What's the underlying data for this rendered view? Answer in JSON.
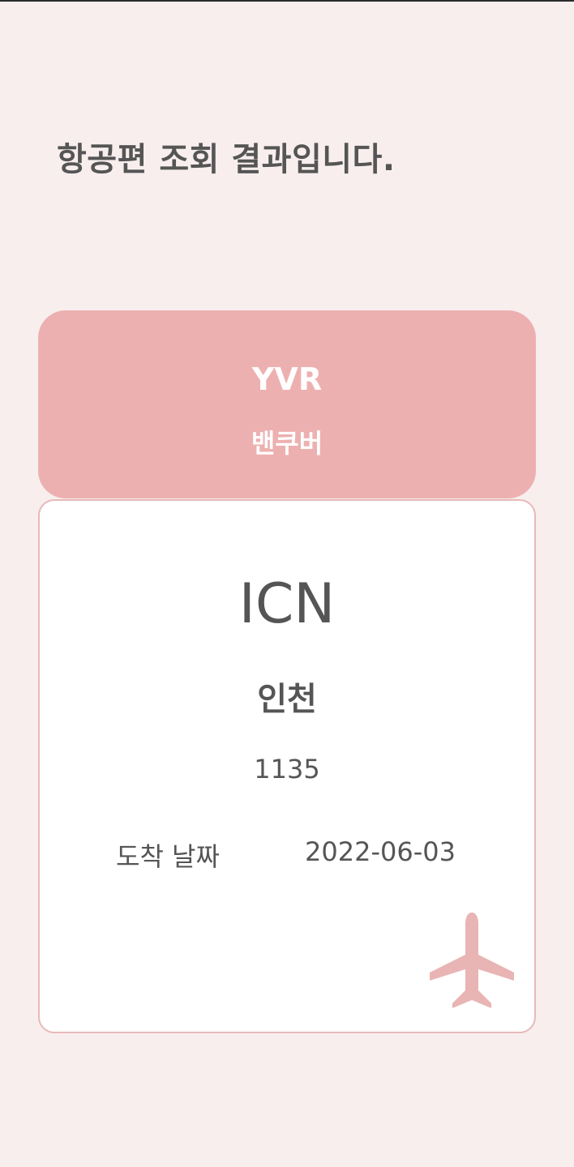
{
  "page": {
    "title": "항공편 조회 결과입니다."
  },
  "origin": {
    "code": "YVR",
    "city": "밴쿠버"
  },
  "destination": {
    "code": "ICN",
    "city": "인천",
    "flight_number": "1135",
    "arrival_label": "도착 날짜",
    "arrival_date": "2022-06-03"
  },
  "icons": {
    "plane": "airplane-icon"
  },
  "colors": {
    "background": "#f8eeee",
    "origin_card": "#edb0b0",
    "dest_card": "#ffffff",
    "dest_border": "#e8b9b9",
    "text": "#555555",
    "origin_text": "#ffffff",
    "plane": "#e9b4b4"
  }
}
